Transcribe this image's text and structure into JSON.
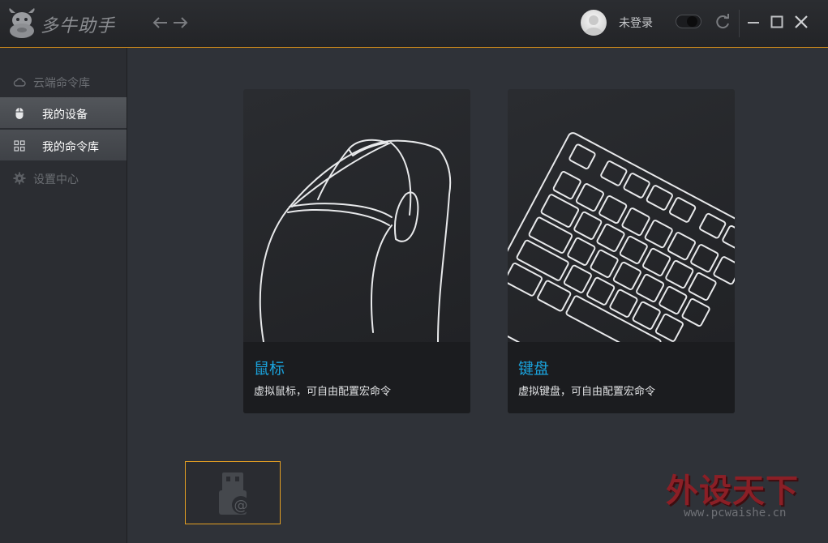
{
  "app": {
    "title": "多牛助手"
  },
  "header": {
    "back_icon": "arrow-left-icon",
    "forward_icon": "arrow-right-icon",
    "login_status": "未登录",
    "toggle_state": "off",
    "accent_color": "#c8861c"
  },
  "sidebar": {
    "items": [
      {
        "label": "云端命令库",
        "icon": "cloud-icon",
        "state": "disabled"
      },
      {
        "label": "我的设备",
        "icon": "mouse-icon",
        "state": "selected"
      },
      {
        "label": "我的命令库",
        "icon": "grid-icon",
        "state": "active"
      },
      {
        "label": "设置中心",
        "icon": "gear-icon",
        "state": "disabled"
      }
    ]
  },
  "cards": [
    {
      "title": "鼠标",
      "desc": "虚拟鼠标，可自由配置宏命令",
      "art": "mouse-outline"
    },
    {
      "title": "键盘",
      "desc": "虚拟键盘，可自由配置宏命令",
      "art": "keyboard-outline"
    }
  ],
  "devices": [
    {
      "icon": "usb-device-icon",
      "highlight_color": "#e5a023"
    }
  ],
  "watermark": {
    "title": "外设天下",
    "url": "www.pcwaishe.cn"
  },
  "colors": {
    "card_title": "#1aa3dd",
    "watermark": "#8b1f26"
  }
}
